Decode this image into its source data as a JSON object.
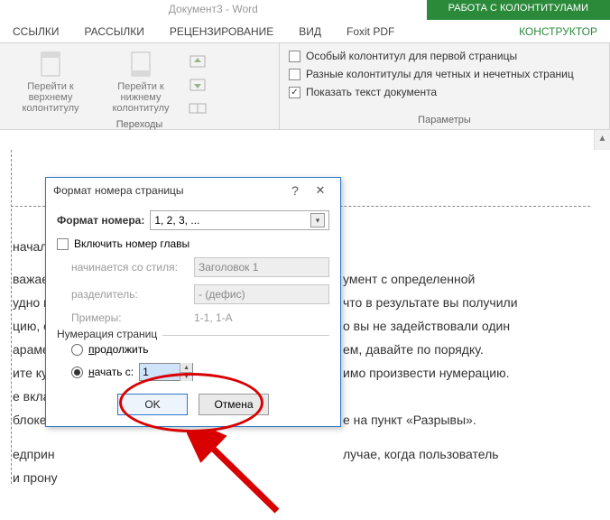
{
  "titlebar": {
    "document": "Документ3 - Word",
    "context_tab": "РАБОТА С КОЛОНТИТУЛАМИ"
  },
  "tabs": {
    "links": "ССЫЛКИ",
    "mail": "РАССЫЛКИ",
    "review": "РЕЦЕНЗИРОВАНИЕ",
    "view": "ВИД",
    "foxit": "Foxit PDF",
    "design": "КОНСТРУКТОР"
  },
  "ribbon": {
    "transitions_group": "Переходы",
    "goto_header": "Перейти к верхнему колонтитулу",
    "goto_footer": "Перейти к нижнему колонтитулу",
    "params_group": "Параметры",
    "opt_first_page": "Особый колонтитул для первой страницы",
    "opt_odd_even": "Разные колонтитулы для четных и нечетных страниц",
    "opt_show_doc": "Показать текст документа"
  },
  "doc_text": {
    "l1": "начала",
    "l2a": "важаем",
    "l2b": "умент с определенной",
    "l3a": "удно пр",
    "l3b": "что в результате вы получили",
    "l4a": "цию, о",
    "l4b": "о вы не задействовали один",
    "l5a": "арамет",
    "l5b": "ем, давайте по порядку.",
    "l6a": "ите кур",
    "l6b": "имо произвести нумерацию.",
    "l7a": "е вклад",
    "l8a": "блоке",
    "l8b": "е на пункт «Разрывы».",
    "l9a": "едприн",
    "l9b": "лучае, когда пользователь",
    "l10": "и прону"
  },
  "dialog": {
    "title": "Формат номера страницы",
    "number_format_label": "Формат номера:",
    "number_format_value": "1, 2, 3, ...",
    "include_chapter": "Включить номер главы",
    "starts_with_style": "начинается со стиля:",
    "style_value": "Заголовок 1",
    "separator": "разделитель:",
    "separator_value": "-   (дефис)",
    "examples": "Примеры:",
    "examples_value": "1-1, 1-A",
    "numbering_legend": "Нумерация страниц",
    "continue": "продолжить",
    "start_from": "начать с:",
    "start_value": "1",
    "ok": "OK",
    "cancel": "Отмена"
  }
}
